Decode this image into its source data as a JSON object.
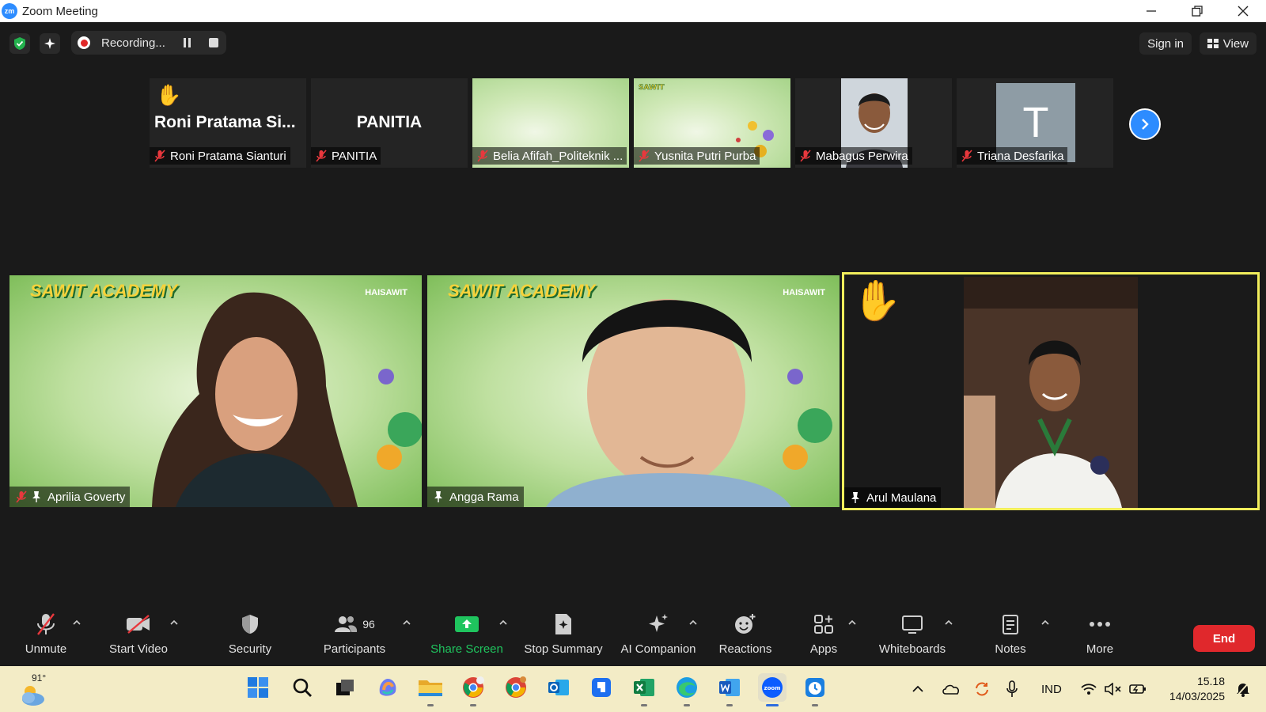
{
  "window": {
    "title": "Zoom Meeting",
    "logo_text": "zm"
  },
  "topbar": {
    "recording_label": "Recording...",
    "sign_in": "Sign in",
    "view": "View"
  },
  "filmstrip": [
    {
      "name": "Roni Pratama Sianturi",
      "display": "Roni Pratama Si...",
      "hand_raised": true,
      "muted": true
    },
    {
      "name": "PANITIA",
      "display": "PANITIA",
      "muted": true
    },
    {
      "name": "Belia Afifah_Politeknik ...",
      "muted": true
    },
    {
      "name": "Yusnita Putri Purba",
      "muted": true
    },
    {
      "name": "Mabagus Perwira",
      "muted": true
    },
    {
      "name": "Triana Desfarika",
      "avatar_letter": "T",
      "muted": true
    }
  ],
  "main_tiles": [
    {
      "name": "Aprilia Goverty",
      "muted": true,
      "pinned": true,
      "logo": "SAWIT ACADEMY",
      "brand": "HAISAWIT"
    },
    {
      "name": "Angga Rama",
      "pinned": true,
      "logo": "SAWIT ACADEMY",
      "brand": "HAISAWIT"
    },
    {
      "name": "Arul Maulana",
      "pinned": true,
      "hand_raised": true,
      "active_speaker": true
    }
  ],
  "toolbar": {
    "unmute": "Unmute",
    "start_video": "Start Video",
    "security": "Security",
    "participants": "Participants",
    "participants_count": "96",
    "share_screen": "Share Screen",
    "stop_summary": "Stop Summary",
    "ai_companion": "AI Companion",
    "reactions": "Reactions",
    "apps": "Apps",
    "whiteboards": "Whiteboards",
    "notes": "Notes",
    "more": "More",
    "end": "End"
  },
  "taskbar": {
    "weather_temp": "91°",
    "language": "IND",
    "time": "15.18",
    "date": "14/03/2025"
  },
  "colors": {
    "zoom_blue": "#2d8cff",
    "end_red": "#e0282c",
    "share_green": "#1fc45e",
    "active_border": "#f2ee5c"
  }
}
